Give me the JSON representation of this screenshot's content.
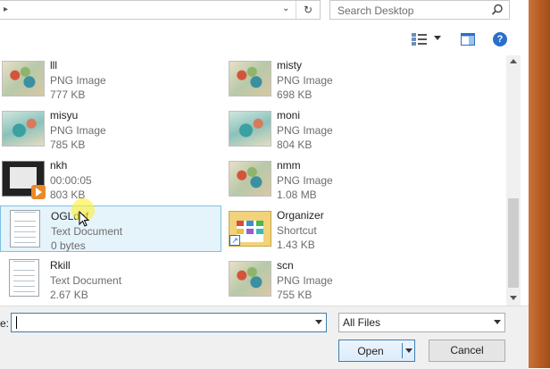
{
  "search": {
    "placeholder": "Search Desktop"
  },
  "files": [
    {
      "name": "lll",
      "line2": "PNG Image",
      "line3": "777 KB",
      "kind": "image"
    },
    {
      "name": "misty",
      "line2": "PNG Image",
      "line3": "698 KB",
      "kind": "image"
    },
    {
      "name": "misyu",
      "line2": "PNG Image",
      "line3": "785 KB",
      "kind": "image"
    },
    {
      "name": "moni",
      "line2": "PNG Image",
      "line3": "804 KB",
      "kind": "image"
    },
    {
      "name": "nkh",
      "line2": "00:00:05",
      "line3": "803 KB",
      "kind": "video"
    },
    {
      "name": "nmm",
      "line2": "PNG Image",
      "line3": "1.08 MB",
      "kind": "image"
    },
    {
      "name": "OGLdpf",
      "line2": "Text Document",
      "line3": "0 bytes",
      "kind": "text",
      "selected": true
    },
    {
      "name": "Organizer",
      "line2": "Shortcut",
      "line3": "1.43 KB",
      "kind": "shortcut"
    },
    {
      "name": "Rkill",
      "line2": "Text Document",
      "line3": "2.67 KB",
      "kind": "text"
    },
    {
      "name": "scn",
      "line2": "PNG Image",
      "line3": "755 KB",
      "kind": "image"
    }
  ],
  "bottom": {
    "filename_label": "e:",
    "filename_value": "",
    "filter_value": "All Files",
    "open_label": "Open",
    "cancel_label": "Cancel"
  },
  "icons": [
    "refresh-icon",
    "search-icon",
    "views-icon",
    "preview-pane-icon",
    "help-icon"
  ],
  "colors": {
    "selection_bg": "#e5f3fb",
    "selection_border": "#7ec0e6",
    "help_blue": "#2a6fc9"
  }
}
